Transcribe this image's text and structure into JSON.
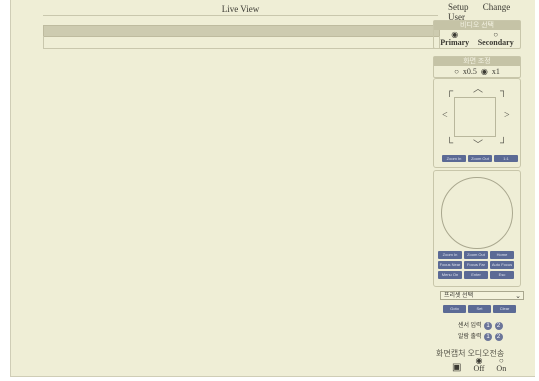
{
  "header": {
    "live_view": "Live View",
    "setup": "Setup",
    "change_user": "Change User"
  },
  "video_select": {
    "title": "비디오 선택",
    "options": [
      {
        "label": "Primary",
        "selected": true
      },
      {
        "label": "Secondary",
        "selected": false
      }
    ]
  },
  "zoom_scale": {
    "title": "화면 조정",
    "options": [
      {
        "label": "x0.5",
        "selected": false
      },
      {
        "label": "x1",
        "selected": true
      }
    ]
  },
  "ptz": {
    "buttons": [
      "Zoom In",
      "Zoom Out",
      "1:1"
    ]
  },
  "control": {
    "buttons": [
      "Zoom In",
      "Zoom Out",
      "Home",
      "Focus Near",
      "Focus Far",
      "Auto Focus",
      "Menu On",
      "Enter",
      "Esc"
    ]
  },
  "preset": {
    "select_label": "프리셋 선택",
    "buttons": [
      "Goto",
      "Set",
      "Clear"
    ]
  },
  "sensor": {
    "rows": [
      {
        "label": "센서 입력",
        "values": [
          "1",
          "2"
        ]
      },
      {
        "label": "알람 출력",
        "values": [
          "1",
          "2"
        ]
      }
    ]
  },
  "audio": {
    "title": "화면캡처 오디오전송",
    "off": "Off",
    "on": "On"
  }
}
